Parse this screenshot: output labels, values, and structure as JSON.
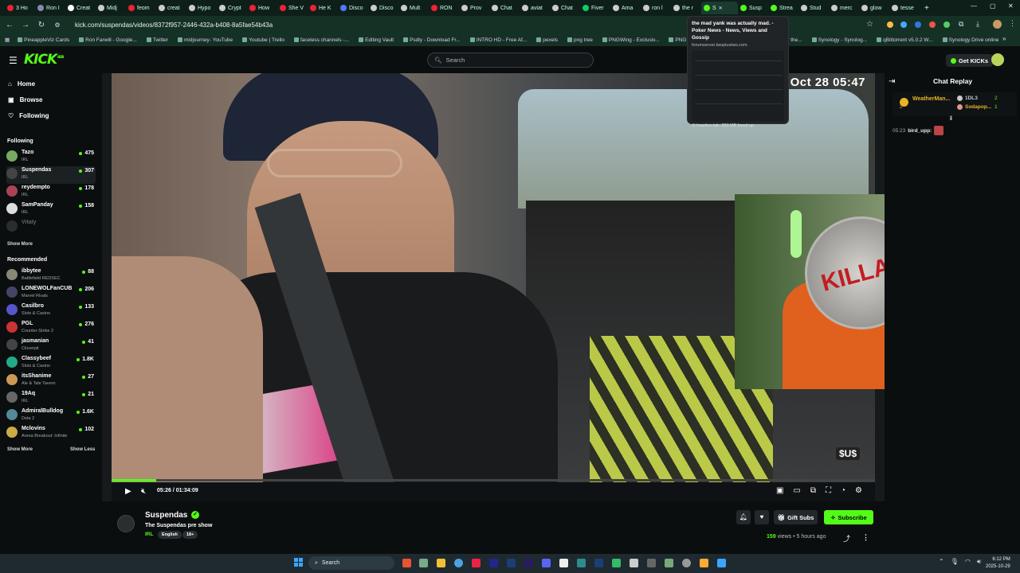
{
  "browser": {
    "tabs": [
      {
        "label": "3 Ho",
        "color": "#e23"
      },
      {
        "label": "Ron I",
        "color": "#88a"
      },
      {
        "label": "Creat",
        "color": "#fff"
      },
      {
        "label": "Midj",
        "color": "#ccc"
      },
      {
        "label": "feom",
        "color": "#e23"
      },
      {
        "label": "creat",
        "color": "#ccc"
      },
      {
        "label": "Hypo",
        "color": "#ccc"
      },
      {
        "label": "Crypt",
        "color": "#ccc"
      },
      {
        "label": "How",
        "color": "#e23"
      },
      {
        "label": "She V",
        "color": "#e23"
      },
      {
        "label": "He K",
        "color": "#e23"
      },
      {
        "label": "Disco",
        "color": "#57f"
      },
      {
        "label": "Disco",
        "color": "#ccc"
      },
      {
        "label": "Mult",
        "color": "#ccc"
      },
      {
        "label": "RON",
        "color": "#e23"
      },
      {
        "label": "Prov",
        "color": "#ccc"
      },
      {
        "label": "Chat",
        "color": "#ccc"
      },
      {
        "label": "aviat",
        "color": "#ccc"
      },
      {
        "label": "Chat",
        "color": "#ccc"
      },
      {
        "label": "Fiver",
        "color": "#1c6"
      },
      {
        "label": "Ama",
        "color": "#ccc"
      },
      {
        "label": "ron l",
        "color": "#ccc"
      },
      {
        "label": "the r",
        "color": "#ccc"
      },
      {
        "label": "S",
        "color": "#53fc18"
      },
      {
        "label": "Susp",
        "color": "#53fc18"
      },
      {
        "label": "Strea",
        "color": "#53fc18"
      },
      {
        "label": "Stud",
        "color": "#ccc"
      },
      {
        "label": "merc",
        "color": "#ccc"
      },
      {
        "label": "glow",
        "color": "#ccc"
      },
      {
        "label": "tesse",
        "color": "#ccc"
      }
    ],
    "active_tab_index": 23,
    "new_tab": "+",
    "url": "kick.com/suspendas/videos/8372f957-2446-432a-b408-8a5fae54b43a",
    "bookmarks": [
      "PineappleViz Cards",
      "Ron Farwill - Google...",
      "Twitter",
      "midjourney- YouTube",
      "Youtube | Trello",
      "faceless channels -...",
      "Editing Vault",
      "Psdly - Download Fr...",
      "INTRO HD - Free Af...",
      "pexels",
      "png tree",
      "PNGWing - Exclusiv...",
      "PNG images | 100 0...",
      "Synology - Synology the...",
      "Synology - Synolog...",
      "qBittorrent v5.0.2 W...",
      "Synology Drive online"
    ]
  },
  "tab_tooltip": {
    "title": "the mad yank was actually mad. - Poker News - News, Views and Gossip",
    "site": "forumserver.twoplustwo.com",
    "memory": "Inactive tab: 393 MB freed up"
  },
  "header": {
    "logo": "KICK",
    "logo_badge": "BETA",
    "search_placeholder": "Search",
    "get_kicks": "Get KICKs"
  },
  "sidebar": {
    "nav": [
      "Home",
      "Browse",
      "Following"
    ],
    "following_title": "Following",
    "following": [
      {
        "name": "Tazo",
        "category": "IRL",
        "viewers": "475",
        "color": "#7a6"
      },
      {
        "name": "Suspendas",
        "category": "IRL",
        "viewers": "307",
        "color": "#444"
      },
      {
        "name": "reydempto",
        "category": "IRL",
        "viewers": "178",
        "color": "#a45"
      },
      {
        "name": "SamPanday",
        "category": "IRL",
        "viewers": "158",
        "color": "#ddd"
      },
      {
        "name": "Vitaly",
        "category": "",
        "viewers": "",
        "color": "#666"
      }
    ],
    "show_more_following": "Show More",
    "recommended_title": "Recommended",
    "recommended": [
      {
        "name": "ibbytee",
        "category": "Battlefield REDSEC",
        "viewers": "88",
        "color": "#887"
      },
      {
        "name": "LONEWOLFanCUB",
        "category": "Marvel Rivals",
        "viewers": "206",
        "color": "#446"
      },
      {
        "name": "Casilbro",
        "category": "Slots & Casino",
        "viewers": "133",
        "color": "#55c"
      },
      {
        "name": "PGL",
        "category": "Counter-Strike 2",
        "viewers": "276",
        "color": "#c33"
      },
      {
        "name": "jasmanian",
        "category": "Cloverpit",
        "viewers": "41",
        "color": "#444"
      },
      {
        "name": "Classybeef",
        "category": "Slots & Casino",
        "viewers": "1.8K",
        "color": "#2a8"
      },
      {
        "name": "itsShanime",
        "category": "Ale & Tale Tavern",
        "viewers": "27",
        "color": "#c95"
      },
      {
        "name": "19Aq",
        "category": "IRL",
        "viewers": "21",
        "color": "#666"
      },
      {
        "name": "AdmiralBulldog",
        "category": "Dota 2",
        "viewers": "1.6K",
        "color": "#589"
      },
      {
        "name": "Mclovins",
        "category": "Arena Breakout: Infinite",
        "viewers": "102",
        "color": "#ca4"
      }
    ],
    "show_more": "Show More",
    "show_less": "Show Less"
  },
  "player": {
    "overlay_time": "Oct 28 05:47",
    "current_time": "05:26",
    "duration": "01:34:09",
    "progress": 0.058,
    "watermark": "$U$"
  },
  "chat": {
    "title": "Chat Replay",
    "pinned_user": "WeatherMan...",
    "pinned_count": "2",
    "gifters": [
      {
        "name": "1DL3",
        "count": "2"
      },
      {
        "name": "Sodapop...",
        "count": "1"
      }
    ],
    "message": {
      "time": "05:23",
      "user": "bird_upp:"
    }
  },
  "stream": {
    "channel": "Suspendas",
    "title": "The Suspendas pre show",
    "category": "IRL",
    "tags": [
      "English",
      "18+"
    ],
    "gift_label": "Gift Subs",
    "subscribe_label": "Subscribe",
    "views": "159",
    "views_label": "views",
    "ago": "5 hours ago"
  },
  "taskbar": {
    "search_label": "Search",
    "time": "6:12 PM",
    "date": "2025-10-29"
  },
  "icons": {
    "home": "home-icon",
    "browse": "compass-icon",
    "following": "heart-icon",
    "search": "search-icon"
  },
  "colors": {
    "accent": "#53fc18",
    "bg": "#0b0e0f"
  }
}
